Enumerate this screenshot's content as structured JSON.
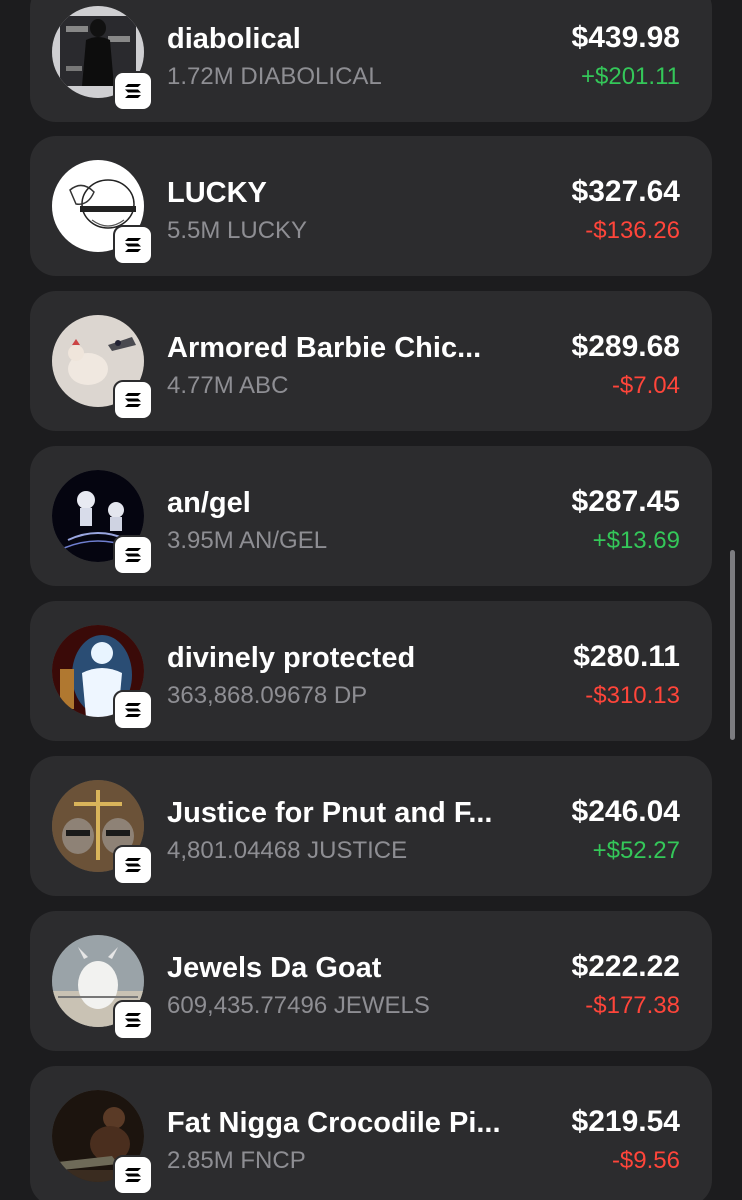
{
  "colors": {
    "positive": "#34c759",
    "negative": "#ff453a"
  },
  "tokens": [
    {
      "name": "diabolical",
      "amount": "1.72M DIABOLICAL",
      "value": "$439.98",
      "change": "+$201.11",
      "direction": "up",
      "avatar_icon": "dark-figure-avatar",
      "chain_icon": "solana-icon"
    },
    {
      "name": "LUCKY",
      "amount": "5.5M LUCKY",
      "value": "$327.64",
      "change": "-$136.26",
      "direction": "down",
      "avatar_icon": "freedom-farm-logo-avatar",
      "chain_icon": "solana-icon"
    },
    {
      "name": "Armored Barbie Chic...",
      "amount": "4.77M ABC",
      "value": "$289.68",
      "change": "-$7.04",
      "direction": "down",
      "avatar_icon": "chicken-avatar",
      "chain_icon": "solana-icon"
    },
    {
      "name": "an/gel",
      "amount": "3.95M AN/GEL",
      "value": "$287.45",
      "change": "+$13.69",
      "direction": "up",
      "avatar_icon": "angel-figures-avatar",
      "chain_icon": "solana-icon"
    },
    {
      "name": "divinely protected",
      "amount": "363,868.09678 DP",
      "value": "$280.11",
      "change": "-$310.13",
      "direction": "down",
      "avatar_icon": "glowing-silhouette-avatar",
      "chain_icon": "solana-icon"
    },
    {
      "name": "Justice for Pnut and F...",
      "amount": "4,801.04468 JUSTICE",
      "value": "$246.04",
      "change": "+$52.27",
      "direction": "up",
      "avatar_icon": "raccoons-scales-avatar",
      "chain_icon": "solana-icon"
    },
    {
      "name": "Jewels Da Goat",
      "amount": "609,435.77496 JEWELS",
      "value": "$222.22",
      "change": "-$177.38",
      "direction": "down",
      "avatar_icon": "goat-avatar",
      "chain_icon": "solana-icon"
    },
    {
      "name": "Fat Nigga Crocodile Pi...",
      "amount": "2.85M FNCP",
      "value": "$219.54",
      "change": "-$9.56",
      "direction": "down",
      "avatar_icon": "crocodile-man-avatar",
      "chain_icon": "solana-icon"
    }
  ]
}
